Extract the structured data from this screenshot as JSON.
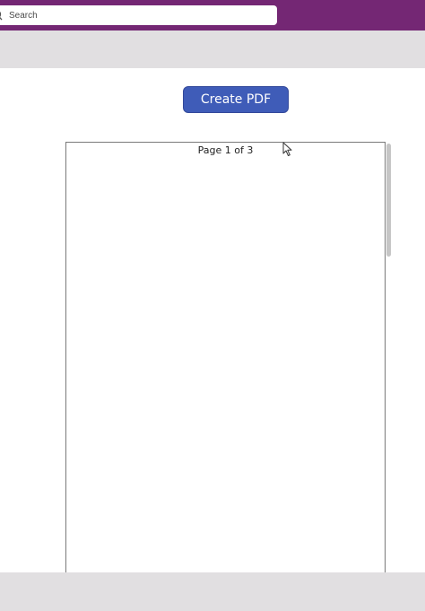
{
  "search": {
    "placeholder": "Search",
    "value": ""
  },
  "actions": {
    "create_pdf_label": "Create PDF"
  },
  "viewer": {
    "page_indicator": "Page 1 of 3",
    "current_page": 1,
    "total_pages": 3
  },
  "colors": {
    "topbar": "#742774",
    "command_bar": "#e1dfe1",
    "button": "#3f5cb8"
  },
  "icons": {
    "search": "search-icon",
    "cursor": "mouse-pointer-icon"
  }
}
